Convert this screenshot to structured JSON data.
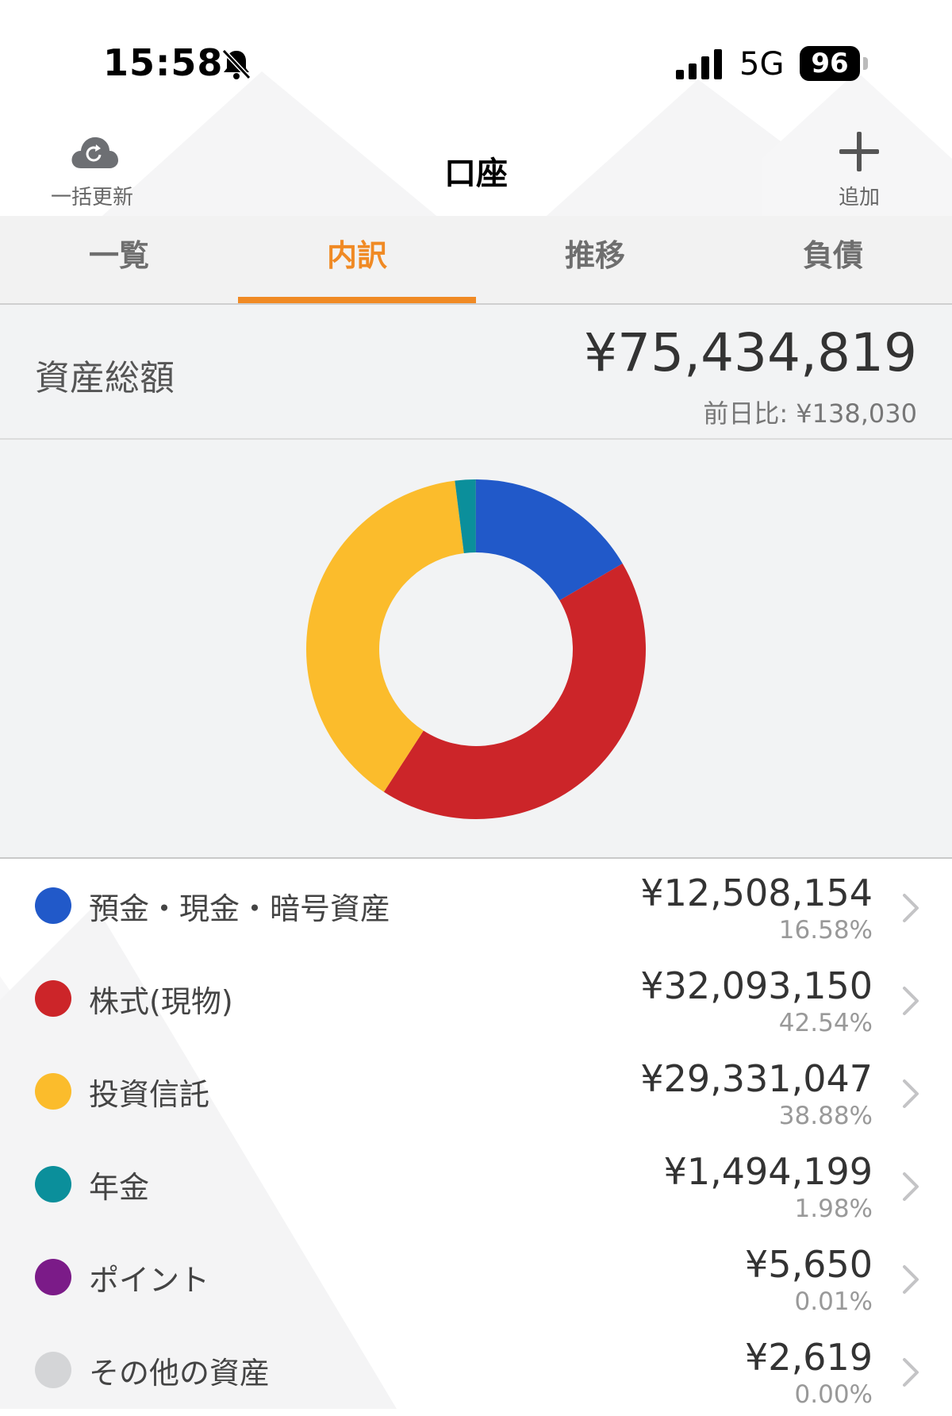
{
  "status_bar": {
    "time": "15:58",
    "network": "5G",
    "battery": "96",
    "icons": [
      "bell-slash-icon",
      "signal-icon"
    ]
  },
  "header": {
    "title": "口座",
    "refresh_label": "一括更新",
    "add_label": "追加",
    "icons": [
      "cloud-refresh-icon",
      "plus-icon"
    ]
  },
  "tabs": [
    {
      "label": "一覧"
    },
    {
      "label": "内訳"
    },
    {
      "label": "推移"
    },
    {
      "label": "負債"
    }
  ],
  "active_tab": "内訳",
  "accent_color": "#f08a24",
  "summary": {
    "label": "資産総額",
    "total": "¥75,434,819",
    "diff": "前日比: ¥138,030"
  },
  "categories": [
    {
      "label": "預金・現金・暗号資産",
      "amount": "¥12,508,154",
      "pct": "16.58%",
      "color": "#2159c9"
    },
    {
      "label": "株式(現物)",
      "amount": "¥32,093,150",
      "pct": "42.54%",
      "color": "#cc2529"
    },
    {
      "label": "投資信託",
      "amount": "¥29,331,047",
      "pct": "38.88%",
      "color": "#fbbc2c"
    },
    {
      "label": "年金",
      "amount": "¥1,494,199",
      "pct": "1.98%",
      "color": "#0b8f9b"
    },
    {
      "label": "ポイント",
      "amount": "¥5,650",
      "pct": "0.01%",
      "color": "#7b1b88"
    },
    {
      "label": "その他の資産",
      "amount": "¥2,619",
      "pct": "0.00%",
      "color": "#d4d5d7"
    }
  ],
  "chart_data": {
    "type": "pie",
    "categories": [
      "預金・現金・暗号資産",
      "株式(現物)",
      "投資信託",
      "年金",
      "ポイント",
      "その他の資産"
    ],
    "values": [
      16.58,
      42.54,
      38.88,
      1.98,
      0.01,
      0.0
    ],
    "colors": [
      "#2159c9",
      "#cc2529",
      "#fbbc2c",
      "#0b8f9b",
      "#7b1b88",
      "#d4d5d7"
    ],
    "donut": true
  }
}
